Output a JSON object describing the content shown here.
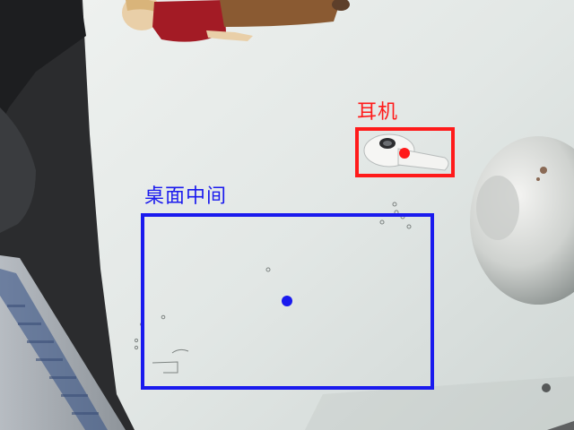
{
  "annotations": [
    {
      "id": "earphone",
      "label": "耳机",
      "color": "#ff1a1a"
    },
    {
      "id": "desk-center",
      "label": "桌面中间",
      "color": "#1a1aee"
    }
  ]
}
